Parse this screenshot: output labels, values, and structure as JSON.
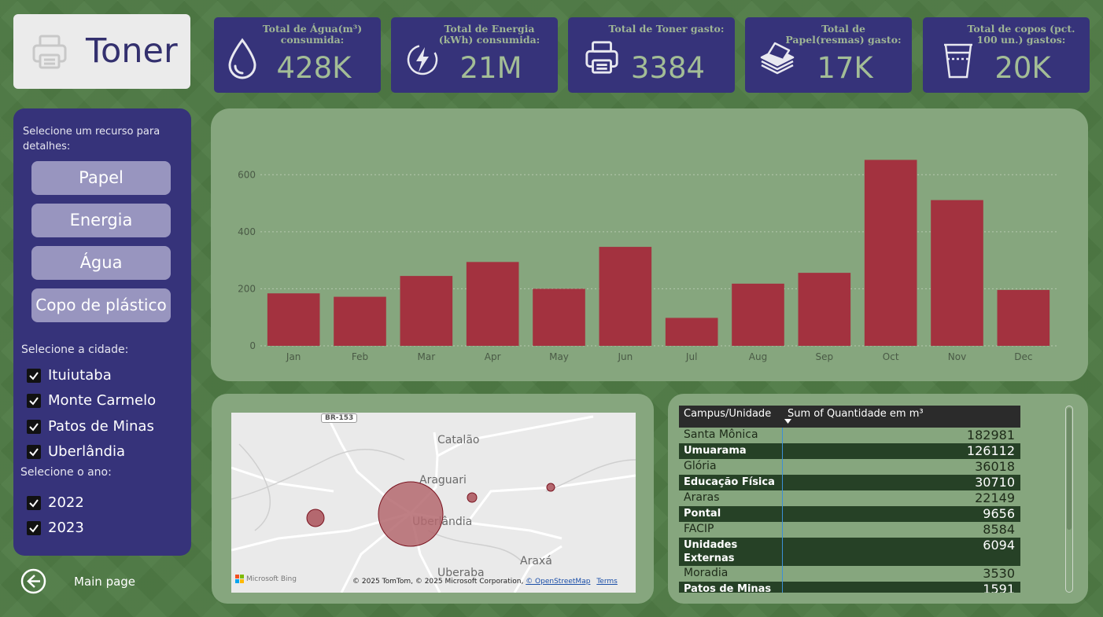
{
  "title": "Toner",
  "kpis": [
    {
      "label": "Total de Água(m³) consumida:",
      "value": "428K",
      "icon": "water-drop-icon"
    },
    {
      "label": "Total de Energia (kWh) consumida:",
      "value": "21M",
      "icon": "lightning-icon"
    },
    {
      "label": "Total de Toner gasto:",
      "value": "3384",
      "icon": "printer-icon"
    },
    {
      "label": "Total de Papel(resmas) gasto:",
      "value": "17K",
      "icon": "paper-stack-icon"
    },
    {
      "label": "Total de copos (pct. 100 un.) gastos:",
      "value": "20K",
      "icon": "plastic-cup-icon"
    }
  ],
  "sidebar": {
    "resource_prompt": "Selecione um recurso para detalhes:",
    "resources": [
      "Papel",
      "Energia",
      "Água",
      "Copo de plástico"
    ],
    "city_prompt": "Selecione a cidade:",
    "cities": [
      "Ituiutaba",
      "Monte Carmelo",
      "Patos de Minas",
      "Uberlândia"
    ],
    "year_prompt": "Selecione o ano:",
    "years": [
      "2022",
      "2023"
    ],
    "back_label": "Main page"
  },
  "chart_data": {
    "type": "bar",
    "categories": [
      "Jan",
      "Feb",
      "Mar",
      "Apr",
      "May",
      "Jun",
      "Jul",
      "Aug",
      "Sep",
      "Oct",
      "Nov",
      "Dec"
    ],
    "values": [
      184,
      172,
      245,
      294,
      200,
      347,
      98,
      218,
      256,
      652,
      511,
      196
    ],
    "yticks": [
      0,
      200,
      400,
      600
    ],
    "ylim": [
      0,
      700
    ],
    "bar_color": "#a3323f",
    "grid": true
  },
  "map": {
    "labels": {
      "road": "BR-153",
      "catalao": "Catalão",
      "araguari": "Araguari",
      "uberlandia": "Uberlândia",
      "uberaba": "Uberaba",
      "araxa": "Araxá"
    },
    "bing_logo": "Microsoft Bing",
    "attribution": "© 2025 TomTom, © 2025 Microsoft Corporation,",
    "osm_link": "© OpenStreetMap",
    "terms_link": "Terms"
  },
  "table": {
    "headers": [
      "Campus/Unidade",
      "Sum of Quantidade em m³"
    ],
    "rows": [
      {
        "name": "Santa Mônica",
        "value": "182981"
      },
      {
        "name": "Umuarama",
        "value": "126112"
      },
      {
        "name": "Glória",
        "value": "36018"
      },
      {
        "name": "Educação Física",
        "value": "30710"
      },
      {
        "name": "Araras",
        "value": "22149"
      },
      {
        "name": "Pontal",
        "value": "9656"
      },
      {
        "name": "FACIP",
        "value": "8584"
      },
      {
        "name": "Unidades Externas",
        "value": "6094"
      },
      {
        "name": "Moradia",
        "value": "3530"
      },
      {
        "name": "Patos de Minas",
        "value": "1591"
      }
    ]
  }
}
